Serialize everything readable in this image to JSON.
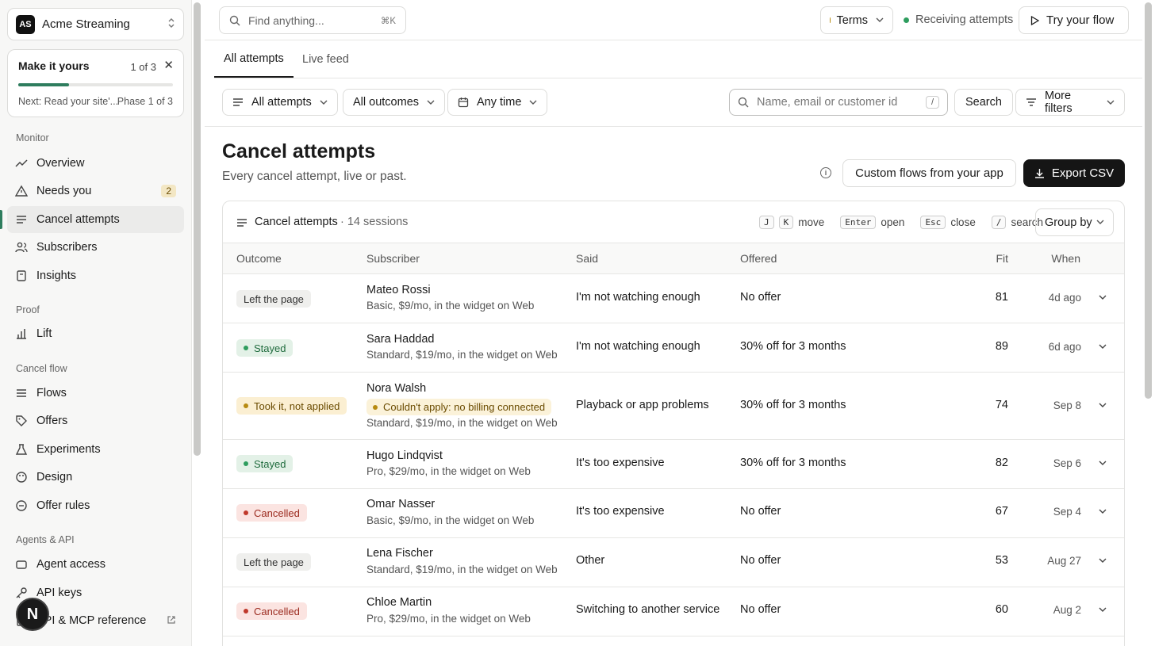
{
  "workspace": {
    "initials": "AS",
    "name": "Acme Streaming"
  },
  "onboarding": {
    "title": "Make it yours",
    "count": "1 of 3",
    "progress": 0.33,
    "next": "Next: Read your site'...",
    "phase": "Phase 1 of 3"
  },
  "sidebar": {
    "monitor_label": "Monitor",
    "monitor": [
      {
        "label": "Overview",
        "icon": "trend-icon"
      },
      {
        "label": "Needs you",
        "icon": "warning-icon",
        "badge": "2"
      },
      {
        "label": "Cancel attempts",
        "icon": "list-icon",
        "active": true
      },
      {
        "label": "Subscribers",
        "icon": "users-icon"
      },
      {
        "label": "Insights",
        "icon": "book-icon"
      }
    ],
    "proof_label": "Proof",
    "proof": [
      {
        "label": "Lift",
        "icon": "bar-chart-icon"
      }
    ],
    "cancel_flow_label": "Cancel flow",
    "cancel_flow": [
      {
        "label": "Flows",
        "icon": "flow-icon"
      },
      {
        "label": "Offers",
        "icon": "tag-icon"
      },
      {
        "label": "Experiments",
        "icon": "flask-icon"
      },
      {
        "label": "Design",
        "icon": "palette-icon"
      },
      {
        "label": "Offer rules",
        "icon": "rules-icon"
      }
    ],
    "agents_label": "Agents & API",
    "agents": [
      {
        "label": "Agent access",
        "icon": "agent-icon"
      },
      {
        "label": "API keys",
        "icon": "key-icon"
      },
      {
        "label": "API & MCP reference",
        "icon": "doc-icon",
        "external": true
      }
    ],
    "fab_label": "N"
  },
  "topbar": {
    "find_placeholder": "Find anything...",
    "find_shortcut": "⌘K",
    "terms_label": "Terms",
    "receiving_label": "Receiving attempts",
    "try_flow_label": "Try your flow"
  },
  "tabs": [
    {
      "label": "All attempts",
      "active": true
    },
    {
      "label": "Live feed"
    }
  ],
  "filters": {
    "attempts": "All attempts",
    "outcomes": "All outcomes",
    "time": "Any time",
    "search_placeholder": "Name, email or customer id",
    "search_slash": "/",
    "search_button": "Search",
    "more_filters": "More filters"
  },
  "page": {
    "title": "Cancel attempts",
    "subtitle": "Every cancel attempt, live or past.",
    "custom_flows_label": "Custom flows from your app",
    "export_label": "Export CSV"
  },
  "table": {
    "title": "Cancel attempts",
    "count": "· 14 sessions",
    "hints": [
      {
        "keys": [
          "J",
          "K"
        ],
        "label": "move"
      },
      {
        "keys": [
          "Enter"
        ],
        "label": "open"
      },
      {
        "keys": [
          "Esc"
        ],
        "label": "close"
      },
      {
        "keys": [
          "/"
        ],
        "label": "search"
      }
    ],
    "group_by": "Group by",
    "columns": {
      "outcome": "Outcome",
      "subscriber": "Subscriber",
      "said": "Said",
      "offered": "Offered",
      "fit": "Fit",
      "when": "When"
    },
    "rows": [
      {
        "outcome": "Left the page",
        "outcome_type": "neutral",
        "name": "Mateo Rossi",
        "plan": "Basic, $9/mo, in the widget on Web",
        "said": "I'm not watching enough",
        "offered": "No offer",
        "fit": "81",
        "when": "4d ago"
      },
      {
        "outcome": "Stayed",
        "outcome_type": "stayed",
        "name": "Sara Haddad",
        "plan": "Standard, $19/mo, in the widget on Web",
        "said": "I'm not watching enough",
        "offered": "30% off for 3 months",
        "fit": "89",
        "when": "6d ago"
      },
      {
        "outcome": "Took it, not applied",
        "outcome_type": "pending",
        "name": "Nora Walsh",
        "warning": "Couldn't apply: no billing connected",
        "plan": "Standard, $19/mo, in the widget on Web",
        "said": "Playback or app problems",
        "offered": "30% off for 3 months",
        "fit": "74",
        "when": "Sep 8"
      },
      {
        "outcome": "Stayed",
        "outcome_type": "stayed",
        "name": "Hugo Lindqvist",
        "plan": "Pro, $29/mo, in the widget on Web",
        "said": "It's too expensive",
        "offered": "30% off for 3 months",
        "fit": "82",
        "when": "Sep 6"
      },
      {
        "outcome": "Cancelled",
        "outcome_type": "cancelled",
        "name": "Omar Nasser",
        "plan": "Basic, $9/mo, in the widget on Web",
        "said": "It's too expensive",
        "offered": "No offer",
        "fit": "67",
        "when": "Sep 4"
      },
      {
        "outcome": "Left the page",
        "outcome_type": "neutral",
        "name": "Lena Fischer",
        "plan": "Standard, $19/mo, in the widget on Web",
        "said": "Other",
        "offered": "No offer",
        "fit": "53",
        "when": "Aug 27"
      },
      {
        "outcome": "Cancelled",
        "outcome_type": "cancelled",
        "name": "Chloe Martin",
        "plan": "Pro, $29/mo, in the widget on Web",
        "said": "Switching to another service",
        "offered": "No offer",
        "fit": "60",
        "when": "Aug 2"
      }
    ]
  },
  "colors": {
    "accent": "#2e7d5e",
    "stayed_bg": "#e3f1e7",
    "stayed_fg": "#1f6b3d",
    "cancelled_bg": "#fbe4e1",
    "cancelled_fg": "#9b2a1e",
    "pending_bg": "#fbefd2",
    "pending_fg": "#6a4b00",
    "neutral_bg": "#efefed",
    "neutral_fg": "#333333"
  }
}
